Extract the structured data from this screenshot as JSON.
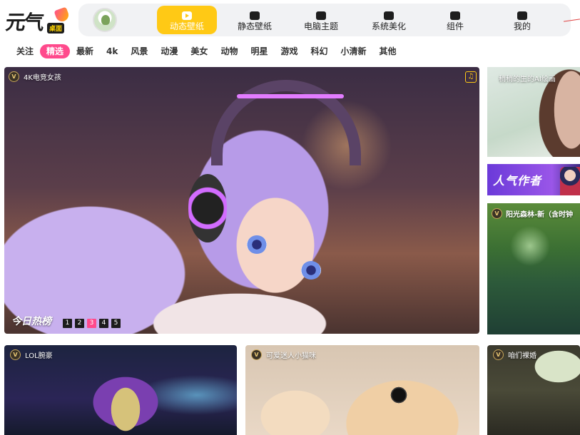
{
  "logo": {
    "text": "元气",
    "badge": "桌面"
  },
  "nav": {
    "items": [
      {
        "label": "动态壁纸",
        "icon": "play-tv-icon",
        "active": true
      },
      {
        "label": "静态壁纸",
        "icon": "image-icon",
        "active": false
      },
      {
        "label": "电脑主题",
        "icon": "shirt-icon",
        "active": false
      },
      {
        "label": "系统美化",
        "icon": "gear-icon",
        "active": false
      },
      {
        "label": "组件",
        "icon": "widget-icon",
        "active": false
      },
      {
        "label": "我的",
        "icon": "user-icon",
        "active": false
      }
    ]
  },
  "categories": [
    "关注",
    "精选",
    "最新",
    "4k",
    "风景",
    "动漫",
    "美女",
    "动物",
    "明星",
    "游戏",
    "科幻",
    "小清新",
    "其他"
  ],
  "active_category": "精选",
  "hero": {
    "tag": "4K电竞女孩",
    "title": "今日热榜",
    "pages": [
      "1",
      "2",
      "3",
      "4",
      "5"
    ],
    "active_page": "3"
  },
  "right": {
    "top_text": "稍稍的生的AI绘画",
    "popular": "人气作者",
    "forest_title": "阳光森林-新（含时钟"
  },
  "cards": [
    {
      "title": "LOL腕豪"
    },
    {
      "title": "可爱迷人小猫咪"
    },
    {
      "title": "咱们裸婚"
    }
  ],
  "colors": {
    "accent": "#ffc915",
    "pink": "#ff4a8c"
  }
}
